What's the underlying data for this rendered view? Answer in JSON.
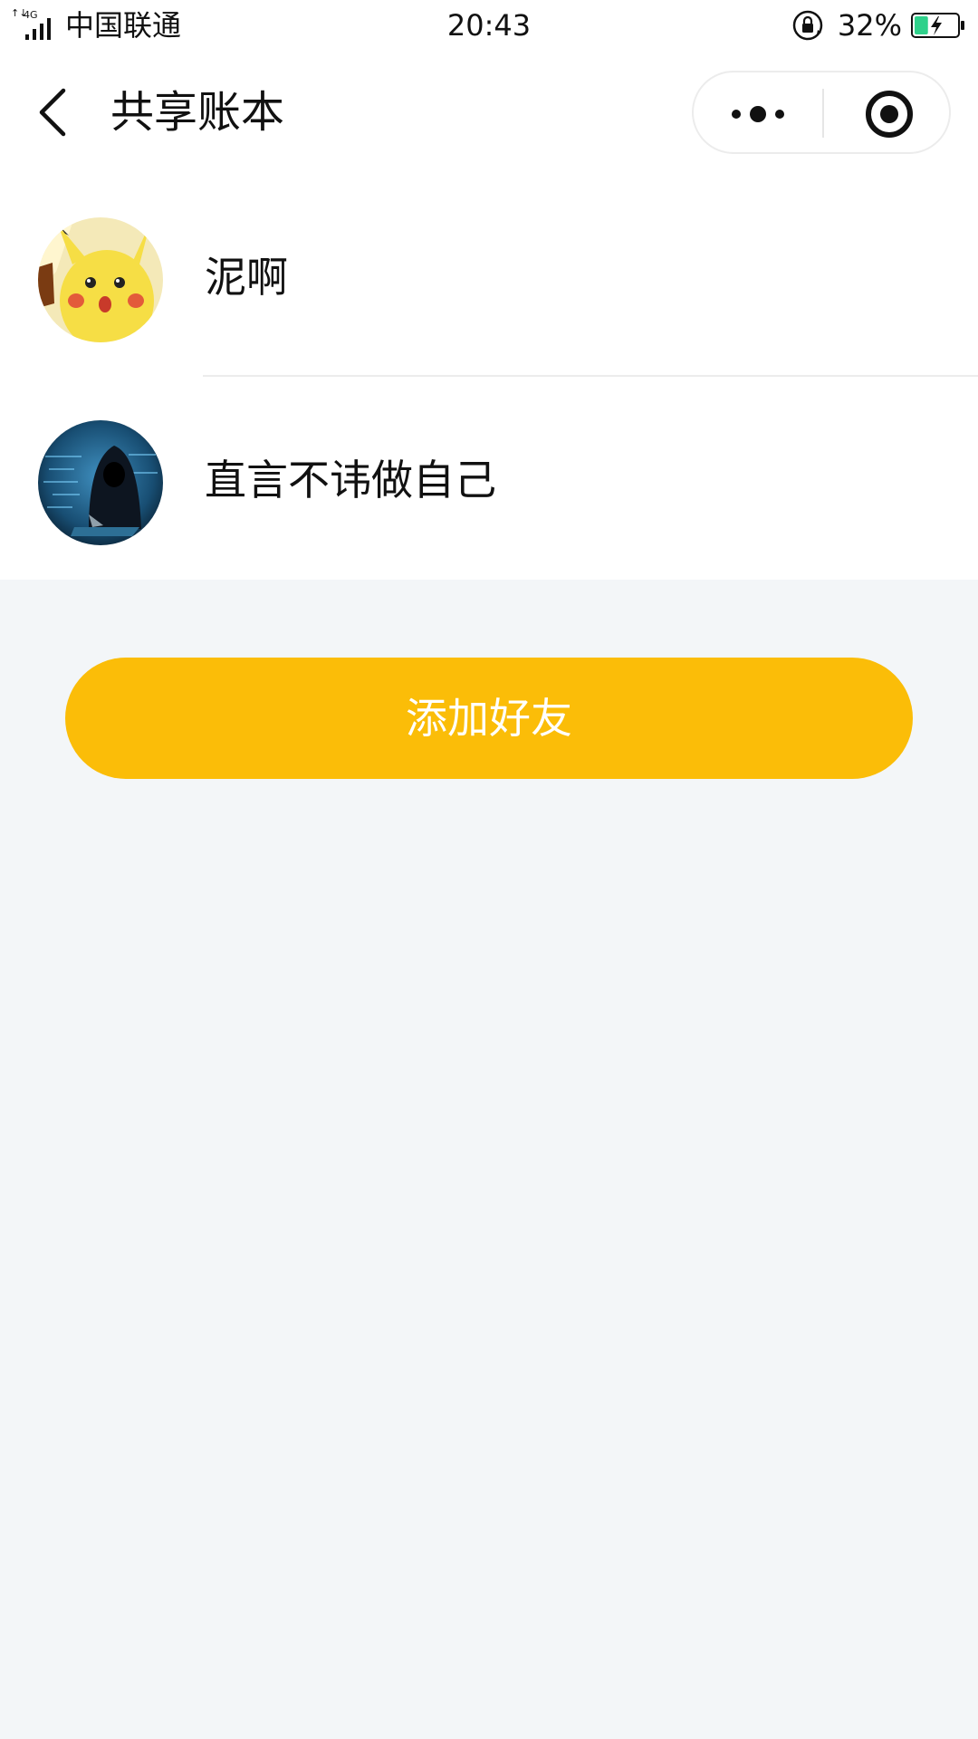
{
  "status_bar": {
    "network": "4G",
    "carrier": "中国联通",
    "time": "20:43",
    "battery_percent": "32%",
    "battery_level": 0.32,
    "battery_color": "#2fd18b"
  },
  "nav": {
    "title": "共享账本",
    "back_icon": "chevron-left-icon",
    "more_icon": "more-dots-icon",
    "close_icon": "target-circle-icon"
  },
  "members": [
    {
      "name": "泥啊",
      "avatar_icon": "pikachu-avatar"
    },
    {
      "name": "直言不讳做自己",
      "avatar_icon": "hooded-hacker-avatar"
    }
  ],
  "actions": {
    "add_friend_label": "添加好友"
  },
  "colors": {
    "accent": "#fbbd08",
    "background": "#f3f6f8",
    "divider": "#ececec"
  }
}
